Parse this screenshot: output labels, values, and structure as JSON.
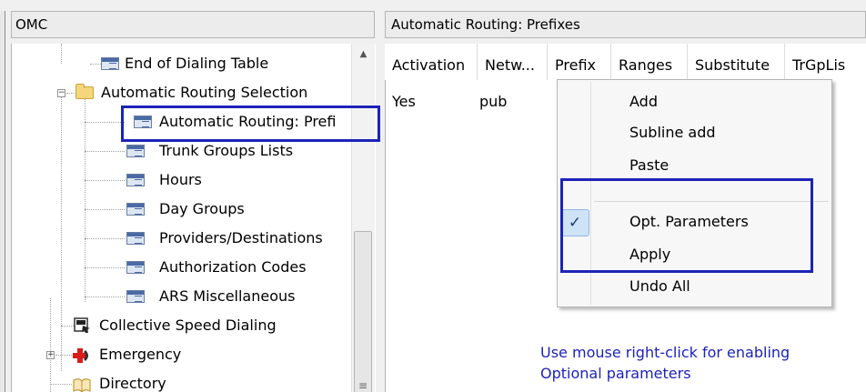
{
  "left_panel": {
    "title": "OMC",
    "tree": [
      {
        "label": "End of Dialing Table",
        "icon": "table-icon"
      },
      {
        "label": "Automatic Routing Selection",
        "icon": "folder-icon",
        "expander": "−"
      },
      {
        "label": "Automatic Routing: Prefi",
        "icon": "table-icon"
      },
      {
        "label": "Trunk Groups Lists",
        "icon": "table-icon"
      },
      {
        "label": "Hours",
        "icon": "table-icon"
      },
      {
        "label": "Day Groups",
        "icon": "table-icon"
      },
      {
        "label": "Providers/Destinations",
        "icon": "table-icon"
      },
      {
        "label": "Authorization Codes",
        "icon": "table-icon"
      },
      {
        "label": "ARS Miscellaneous",
        "icon": "table-icon"
      },
      {
        "label": "Collective Speed Dialing",
        "icon": "speed-dial-icon"
      },
      {
        "label": "Emergency",
        "icon": "emergency-icon",
        "expander": "+"
      },
      {
        "label": "Directory",
        "icon": "directory-icon"
      }
    ]
  },
  "right_panel": {
    "title": "Automatic Routing: Prefixes",
    "columns": [
      "Activation",
      "Netw...",
      "Prefix",
      "Ranges",
      "Substitute",
      "TrGpLis"
    ],
    "rows": [
      [
        "Yes",
        "pub",
        "",
        "",
        "",
        ""
      ]
    ]
  },
  "context_menu": {
    "items": [
      {
        "label": "Add",
        "checked": false
      },
      {
        "label": "Subline add",
        "checked": false
      },
      {
        "label": "Paste",
        "checked": false
      },
      {
        "label": "Opt. Parameters",
        "checked": true
      },
      {
        "label": "Apply",
        "checked": false
      },
      {
        "label": "Undo All",
        "checked": false
      }
    ],
    "check_glyph": "✓"
  },
  "annotation": {
    "line1": "Use mouse right-click for enabling",
    "line2": "Optional parameters",
    "color": "#1d23b8"
  }
}
